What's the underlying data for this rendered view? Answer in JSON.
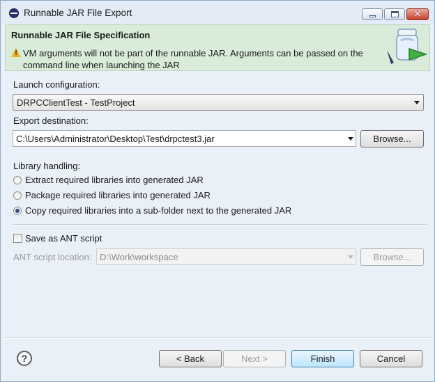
{
  "window": {
    "title": "Runnable JAR File Export"
  },
  "banner": {
    "title": "Runnable JAR File Specification",
    "message": "VM arguments will not be part of the runnable JAR. Arguments can be passed on the command line when launching the JAR"
  },
  "launch": {
    "label": "Launch configuration:",
    "value": "DRPCClientTest - TestProject"
  },
  "export": {
    "label": "Export destination:",
    "value": "C:\\Users\\Administrator\\Desktop\\Test\\drpctest3.jar",
    "browse_label": "Browse..."
  },
  "library": {
    "label": "Library handling:",
    "options": [
      {
        "label": "Extract required libraries into generated JAR",
        "checked": false
      },
      {
        "label": "Package required libraries into generated JAR",
        "checked": false
      },
      {
        "label": "Copy required libraries into a sub-folder next to the generated JAR",
        "checked": true
      }
    ]
  },
  "ant": {
    "checkbox_label": "Save as ANT script",
    "checked": false,
    "location_label": "ANT script location:",
    "location_value": "D:\\Work\\workspace",
    "browse_label": "Browse..."
  },
  "footer": {
    "help_glyph": "?",
    "back_label": "< Back",
    "next_label": "Next >",
    "finish_label": "Finish",
    "cancel_label": "Cancel"
  },
  "icons": {
    "app": "eclipse-icon",
    "warning": "warning-icon",
    "wizard": "jar-export-wizard-graphic",
    "help": "help-icon"
  }
}
